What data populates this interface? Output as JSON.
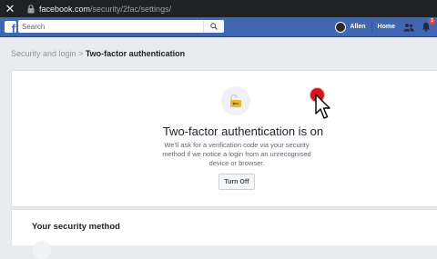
{
  "browser": {
    "url_domain": "facebook.com",
    "url_path": "/security/2fac/settings/"
  },
  "navbar": {
    "search_placeholder": "Search",
    "user_name": "Allen",
    "home_label": "Home",
    "notifications_count": "1"
  },
  "breadcrumb": {
    "parent": "Security and login",
    "separator": ">",
    "current": "Two-factor authentication"
  },
  "status": {
    "heading": "Two-factor authentication is on",
    "description": "We'll ask for a verification code via your security method if we notice a login from an unrecognised device or browser.",
    "turn_off_label": "Turn Off"
  },
  "security_method": {
    "title": "Your security method"
  },
  "colors": {
    "facebook_blue": "#4267b2",
    "lock_gold": "#e8b83a",
    "click_indicator": "#e0101a"
  }
}
